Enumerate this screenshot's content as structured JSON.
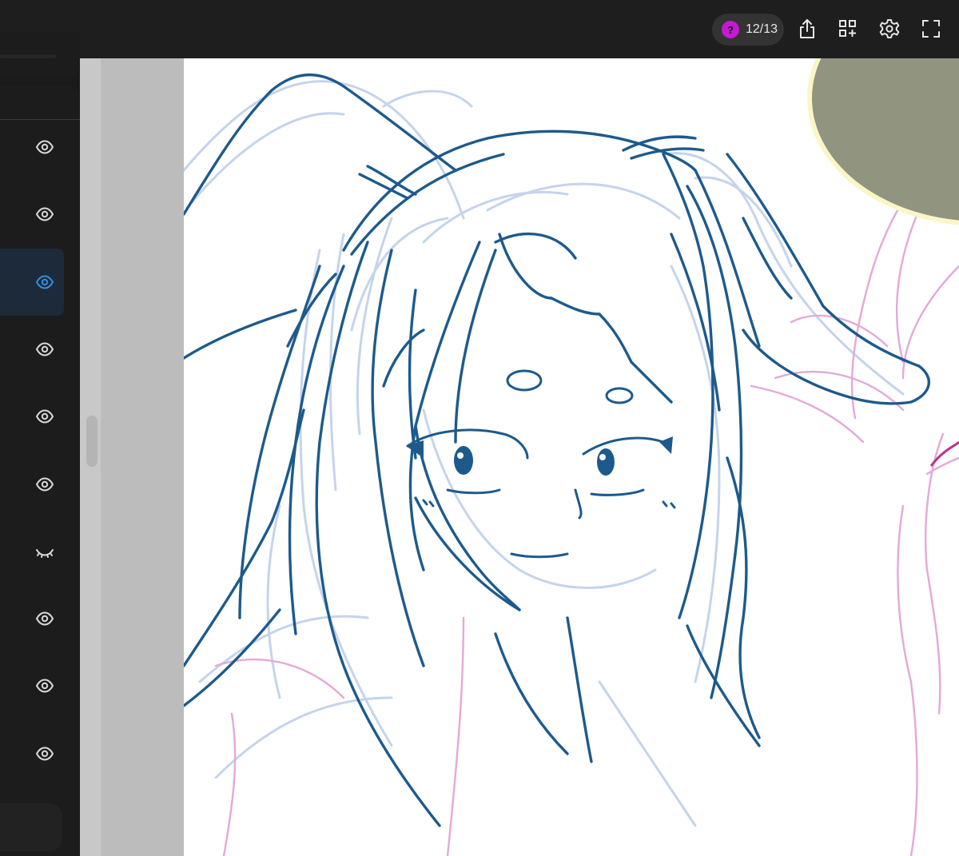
{
  "toolbar": {
    "badge_icon": "question-mark-icon",
    "badge_glyph": "?",
    "badge_text": "12/13",
    "badge_color": "#c21ad1",
    "icons": [
      "share-icon",
      "add-widget-icon",
      "settings-gear-icon",
      "fullscreen-icon"
    ]
  },
  "layers_panel": {
    "rows": [
      {
        "visibility": "visible",
        "active": false
      },
      {
        "visibility": "visible",
        "active": false
      },
      {
        "visibility": "visible",
        "active": true
      },
      {
        "visibility": "visible",
        "active": false
      },
      {
        "visibility": "visible",
        "active": false
      },
      {
        "visibility": "visible",
        "active": false
      },
      {
        "visibility": "hidden",
        "active": false
      },
      {
        "visibility": "visible",
        "active": false
      },
      {
        "visibility": "visible",
        "active": false
      },
      {
        "visibility": "visible",
        "active": false
      },
      {
        "visibility": "visible",
        "active": false
      }
    ]
  },
  "canvas": {
    "background": "#ffffff",
    "ink_color": "#1d5a8c",
    "sketch_blue": "#c5d4ea",
    "sketch_pink": "#e3a9d8",
    "color_swatch": "#91947f",
    "color_swatch_ring": "#fbf6c6"
  }
}
